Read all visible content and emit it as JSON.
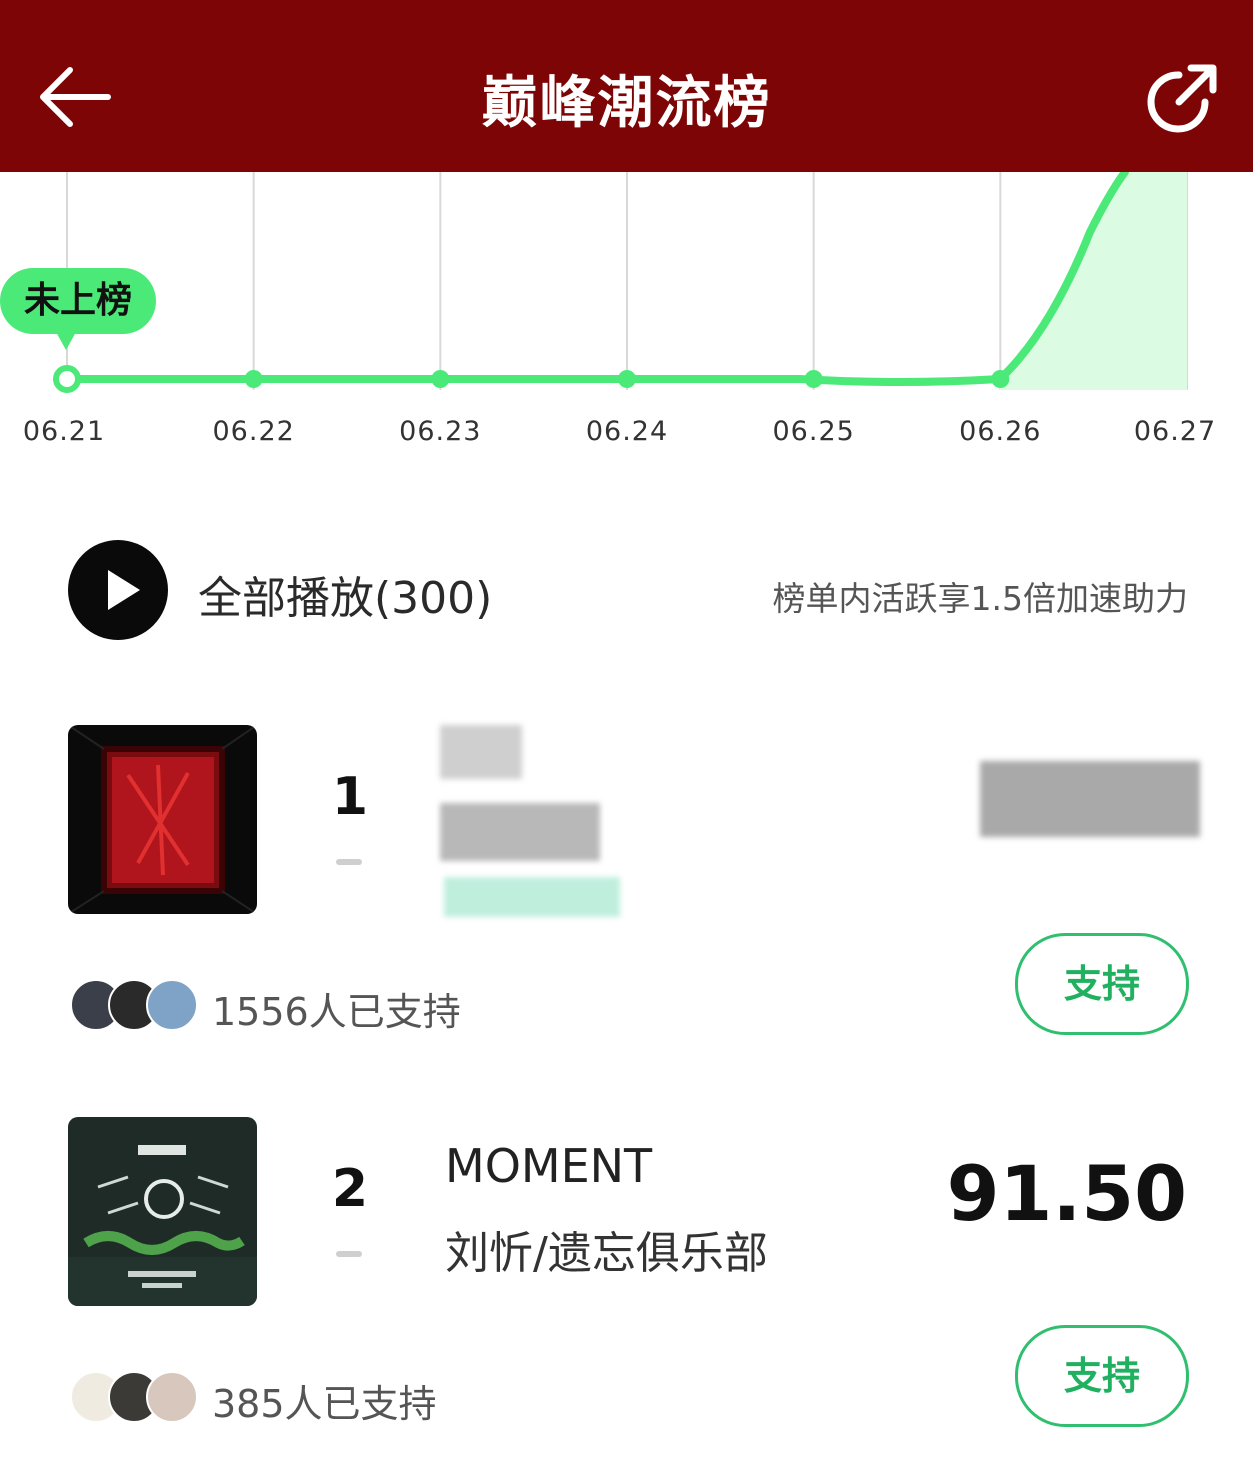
{
  "header": {
    "title": "巅峰潮流榜"
  },
  "chart_data": {
    "type": "line",
    "x": [
      "06.21",
      "06.22",
      "06.23",
      "06.24",
      "06.25",
      "06.26",
      "06.27"
    ],
    "marker_label": "未上榜"
  },
  "playall": {
    "label": "全部播放(300)",
    "note": "榜单内活跃享1.5倍加速助力"
  },
  "entries": [
    {
      "rank": "1",
      "title": "",
      "artist": "",
      "score": "",
      "supporters": "1556人已支持",
      "support_label": "支持"
    },
    {
      "rank": "2",
      "title": "MOMENT",
      "artist": "刘忻/遗忘俱乐部",
      "score": "91.50",
      "supporters": "385人已支持",
      "support_label": "支持"
    }
  ],
  "colors": {
    "header_bg": "#7e0505",
    "line": "#4bea78",
    "button": "#2fbf6f"
  }
}
